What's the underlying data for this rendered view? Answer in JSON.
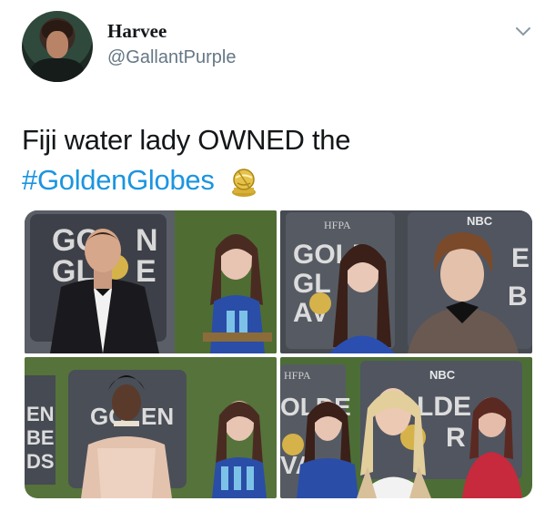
{
  "header": {
    "display_name": "Harvee",
    "handle": "@GallantPurple",
    "menu_icon": "chevron-down-icon"
  },
  "tweet": {
    "line1": "Fiji water lady OWNED the",
    "hashtag": "#GoldenGlobes",
    "emoji_icon": "golden-globe-award-emoji"
  },
  "colors": {
    "hashtag": "#1b95e0",
    "handle": "#657786",
    "text": "#14171a"
  },
  "photos": {
    "p1": {
      "backdrop": "GOLDEN GLOBES",
      "l1": "GOL",
      "l2": "GL",
      "l3": "N",
      "l4": "E"
    },
    "p2": {
      "backdrop": "HFPA",
      "sign": "NBC",
      "l1": "GOLD",
      "l2": "GL",
      "l3": "AV",
      "l4": "E",
      "l5": "B"
    },
    "p3": {
      "backdrop": "GOLDEN",
      "l1": "EN",
      "l2": "BE",
      "l3": "DS",
      "l4": "GO",
      "l5": "EN"
    },
    "p4": {
      "backdrop": "HFPA",
      "sign": "NBC",
      "l1": "OLDE",
      "l2": "VA",
      "l3": "LDE",
      "l4": "R"
    }
  }
}
